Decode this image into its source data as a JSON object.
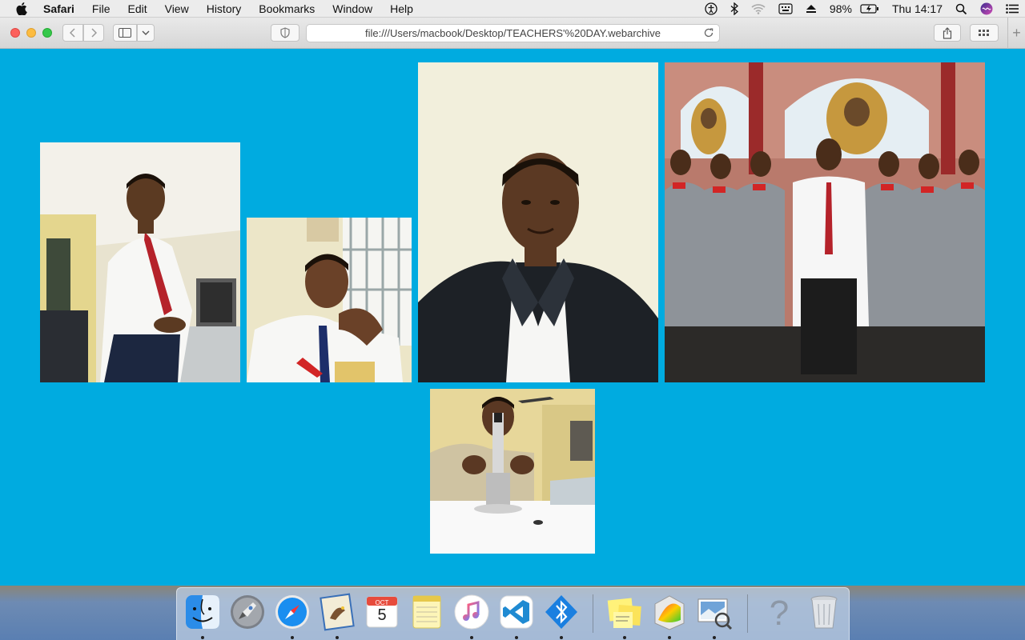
{
  "menubar": {
    "app_name": "Safari",
    "menus": [
      "File",
      "Edit",
      "View",
      "History",
      "Bookmarks",
      "Window",
      "Help"
    ],
    "battery": "98%",
    "clock": "Thu 14:17"
  },
  "toolbar": {
    "url": "file:///Users/macbook/Desktop/TEACHERS'%20DAY.webarchive"
  },
  "page": {
    "background": "#00abe0",
    "photos": [
      {
        "id": "photo-teacher-classroom-red-tie",
        "description": "man in white shirt and red tie standing in classroom"
      },
      {
        "id": "photo-teacher-smiling-seated",
        "description": "smiling man seated by window"
      },
      {
        "id": "photo-teacher-portrait-suit",
        "description": "man in dark suit portrait"
      },
      {
        "id": "photo-teacher-with-students",
        "description": "teacher with students in grey blazers and red bow ties"
      },
      {
        "id": "photo-teacher-microscope",
        "description": "man using microscope in lab"
      }
    ]
  },
  "dock": {
    "calendar_month": "OCT",
    "calendar_day": "5",
    "items": [
      "finder",
      "launchpad",
      "safari",
      "mail",
      "calendar",
      "notes",
      "itunes",
      "vscode",
      "bluetooth-file-exchange",
      "stickies",
      "grapher",
      "preview",
      "help",
      "trash"
    ]
  }
}
